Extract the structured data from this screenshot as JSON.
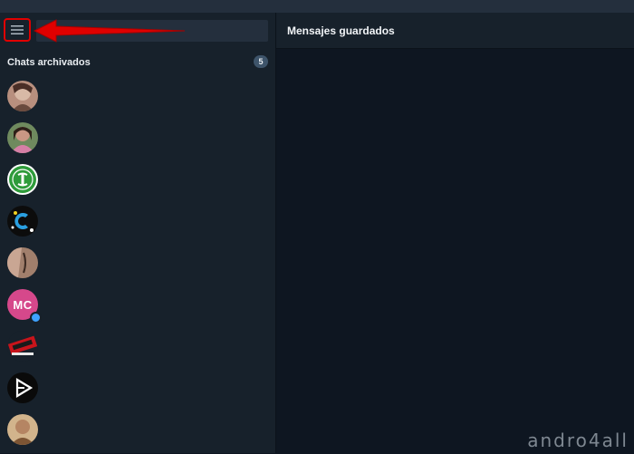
{
  "sidebar": {
    "menu_icon": "hamburger-menu-icon",
    "archived": {
      "label": "Chats archivados",
      "count": "5"
    },
    "chats": [
      {
        "avatar": "photo-woman-selfie"
      },
      {
        "avatar": "photo-woman-pink"
      },
      {
        "avatar": "logo-green-exchange"
      },
      {
        "avatar": "logo-blue-c"
      },
      {
        "avatar": "photo-skin-tone"
      },
      {
        "avatar": "initials",
        "initials": "MC",
        "color": "#d6488b",
        "online": true
      },
      {
        "avatar": "logo-red-black-badge"
      },
      {
        "avatar": "logo-play-triangle"
      },
      {
        "avatar": "photo-woman-beige"
      }
    ]
  },
  "main": {
    "title": "Mensajes guardados"
  },
  "annotation": {
    "arrow_color": "#e00000"
  },
  "watermark": "andro4all"
}
